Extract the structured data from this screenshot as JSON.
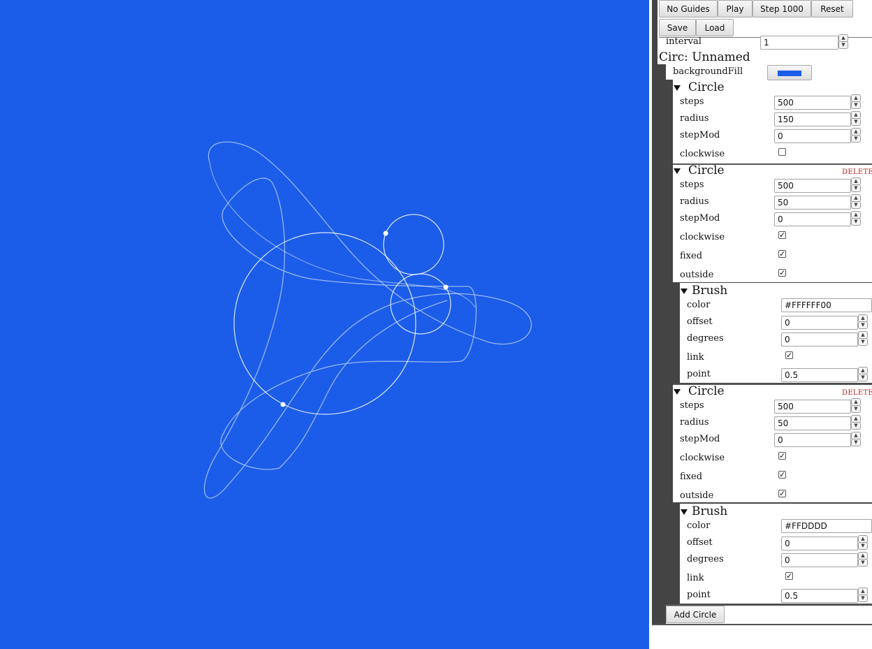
{
  "toolbar": {
    "no_guides": "No Guides",
    "play": "Play",
    "step": "Step 1000",
    "reset": "Reset",
    "save": "Save",
    "load": "Load"
  },
  "interval": {
    "label": "interval",
    "value": "1"
  },
  "circ": {
    "title": "Circ: Unnamed",
    "background_label": "backgroundFill",
    "background_color": "#1b5de9"
  },
  "circles": [
    {
      "title": "Circle",
      "steps_label": "steps",
      "steps": "500",
      "radius_label": "radius",
      "radius": "150",
      "stepmod_label": "stepMod",
      "stepmod": "0",
      "clockwise_label": "clockwise",
      "clockwise": false
    },
    {
      "title": "Circle",
      "delete": "DELETE",
      "steps_label": "steps",
      "steps": "500",
      "radius_label": "radius",
      "radius": "50",
      "stepmod_label": "stepMod",
      "stepmod": "0",
      "clockwise_label": "clockwise",
      "clockwise": true,
      "fixed_label": "fixed",
      "fixed": true,
      "outside_label": "outside",
      "outside": true,
      "brush": {
        "title": "Brush",
        "color_label": "color",
        "color": "#FFFFFF00",
        "offset_label": "offset",
        "offset": "0",
        "degrees_label": "degrees",
        "degrees": "0",
        "link_label": "link",
        "link": true,
        "point_label": "point",
        "point": "0.5"
      }
    },
    {
      "title": "Circle",
      "delete": "DELETE",
      "steps_label": "steps",
      "steps": "500",
      "radius_label": "radius",
      "radius": "50",
      "stepmod_label": "stepMod",
      "stepmod": "0",
      "clockwise_label": "clockwise",
      "clockwise": true,
      "fixed_label": "fixed",
      "fixed": true,
      "outside_label": "outside",
      "outside": true,
      "brush": {
        "title": "Brush",
        "color_label": "color",
        "color": "#FFDDDD",
        "offset_label": "offset",
        "offset": "0",
        "degrees_label": "degrees",
        "degrees": "0",
        "link_label": "link",
        "link": true,
        "point_label": "point",
        "point": "0.5"
      }
    }
  ],
  "add_circle": "Add Circle",
  "checkmark": "✓",
  "spin_up": "▲",
  "spin_down": "▼"
}
